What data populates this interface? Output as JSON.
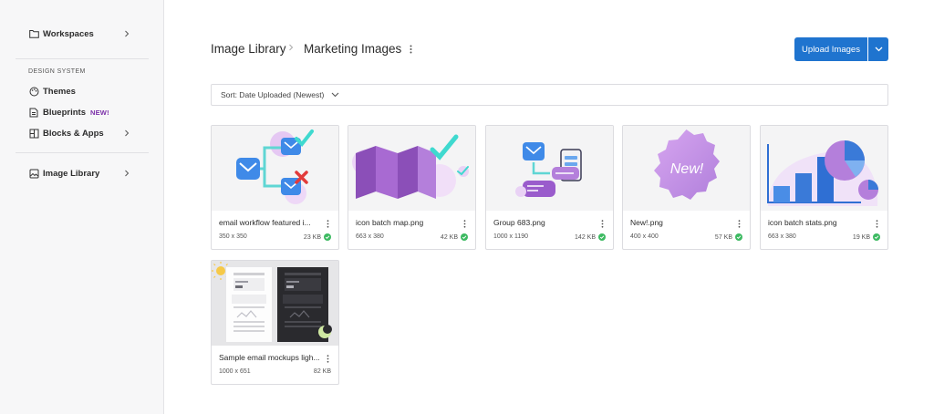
{
  "sidebar": {
    "items_top": [
      {
        "label": "Workspaces",
        "icon": "folder-icon",
        "has_chevron": true
      }
    ],
    "section_label": "DESIGN SYSTEM",
    "design_items": [
      {
        "label": "Themes",
        "icon": "palette-icon"
      },
      {
        "label": "Blueprints",
        "icon": "blueprint-icon",
        "badge": "NEW!"
      },
      {
        "label": "Blocks & Apps",
        "icon": "blocks-icon",
        "has_chevron": true
      }
    ],
    "library_item": {
      "label": "Image Library",
      "icon": "image-icon",
      "has_chevron": true
    }
  },
  "header": {
    "breadcrumb_root": "Image Library",
    "breadcrumb_current": "Marketing Images",
    "upload_label": "Upload Images"
  },
  "sort": {
    "label": "Sort: Date Uploaded (Newest)"
  },
  "images": [
    {
      "name": "email workflow featured i...",
      "dimensions": "350 x 350",
      "size": "23 KB",
      "verified": true,
      "thumb": "email-workflow"
    },
    {
      "name": "icon batch map.png",
      "dimensions": "663 x 380",
      "size": "42 KB",
      "verified": true,
      "thumb": "map"
    },
    {
      "name": "Group 683.png",
      "dimensions": "1000 x 1190",
      "size": "142 KB",
      "verified": true,
      "thumb": "group"
    },
    {
      "name": "New!.png",
      "dimensions": "400 x 400",
      "size": "57 KB",
      "verified": true,
      "thumb": "new-badge",
      "thumb_text": "New!"
    },
    {
      "name": "icon batch stats.png",
      "dimensions": "663 x 380",
      "size": "19 KB",
      "verified": true,
      "thumb": "stats"
    },
    {
      "name": "Sample email mockups ligh...",
      "dimensions": "1000 x 651",
      "size": "82 KB",
      "verified": false,
      "thumb": "mockups"
    }
  ],
  "colors": {
    "accent": "#1f74cf",
    "badge_purple": "#7b2fa8",
    "success": "#3dba62"
  }
}
